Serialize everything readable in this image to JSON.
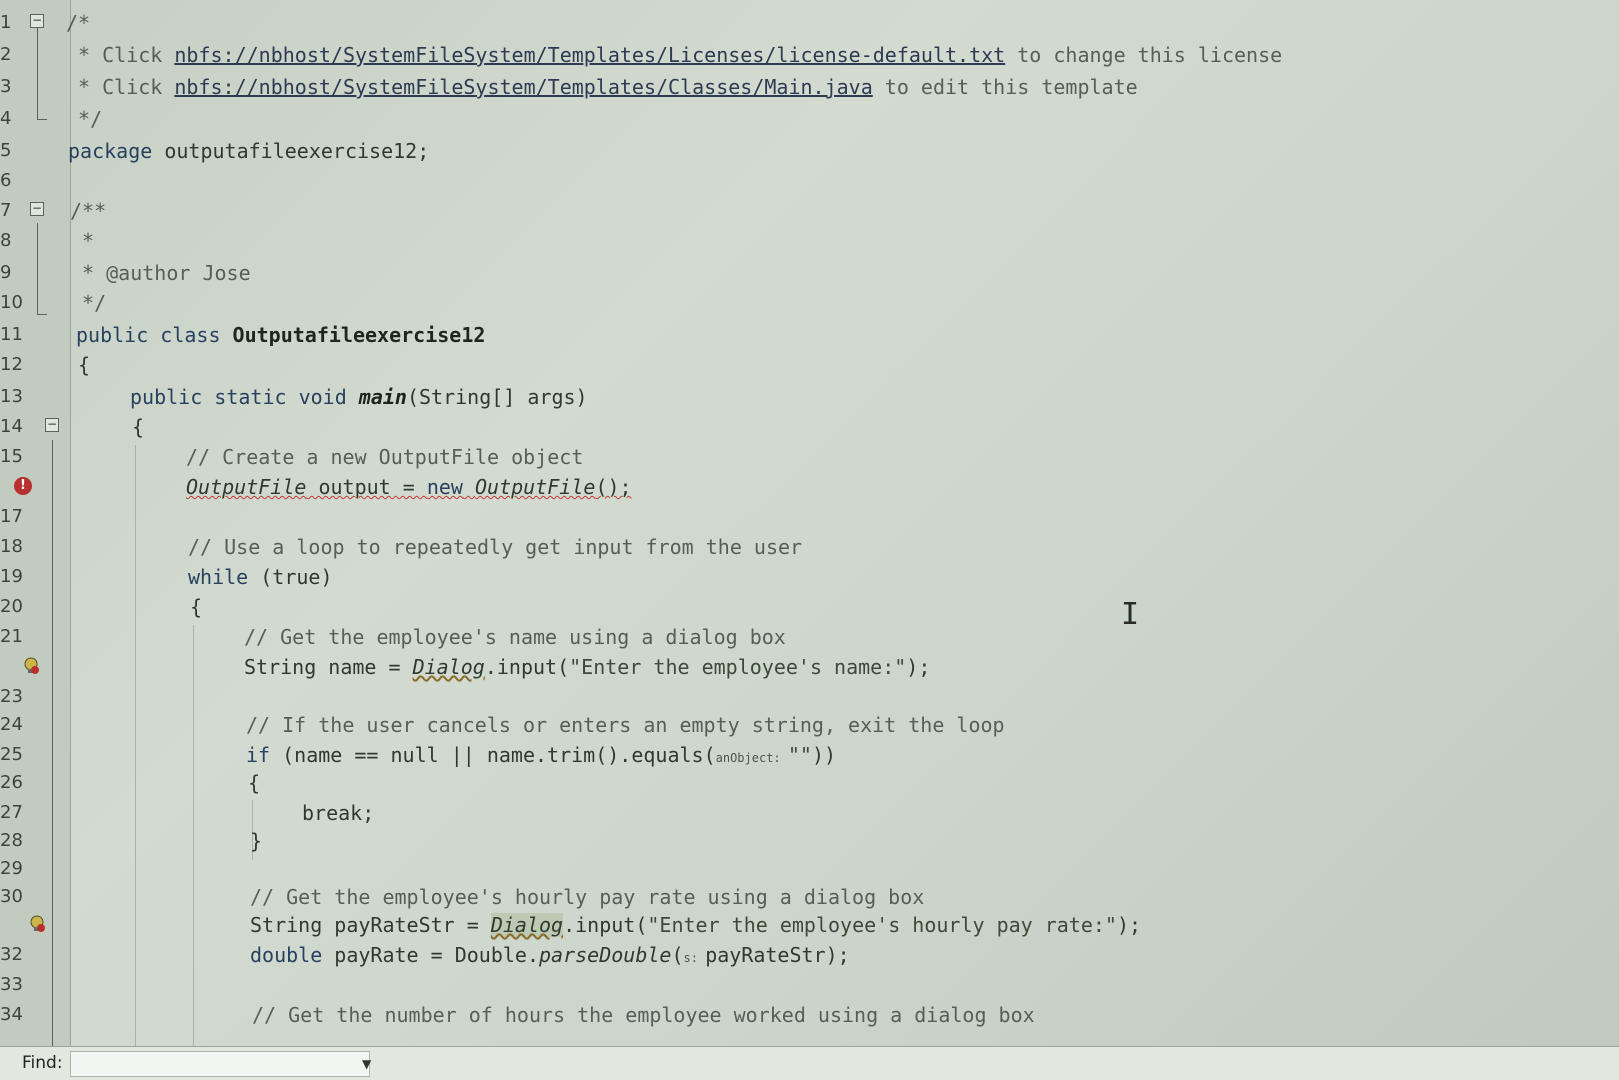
{
  "gutter": {
    "numbers": [
      "1",
      "2",
      "3",
      "4",
      "5",
      "6",
      "7",
      "8",
      "9",
      "10",
      "11",
      "12",
      "13",
      "14",
      "15",
      "",
      "17",
      "18",
      "19",
      "20",
      "21",
      "",
      "23",
      "24",
      "25",
      "26",
      "27",
      "28",
      "29",
      "30",
      "",
      "32",
      "33",
      "34"
    ]
  },
  "code": {
    "l1": "/*",
    "l2_pre": " * Click ",
    "l2_link": "nbfs://nbhost/SystemFileSystem/Templates/Licenses/license-default.txt",
    "l2_post": " to change this license",
    "l3_pre": " * Click ",
    "l3_link": "nbfs://nbhost/SystemFileSystem/Templates/Classes/Main.java",
    "l3_post": " to edit this template",
    "l4": " */",
    "l5_kw": "package",
    "l5_rest": " outputafileexercise12;",
    "l7": "/**",
    "l8": " *",
    "l9": " * @author Jose",
    "l10": " */",
    "l11_kw": "public class ",
    "l11_cls": "Outputafileexercise12",
    "l12": "{",
    "l13_kw": "public static void ",
    "l13_method": "main",
    "l13_rest": "(String[] args)",
    "l14": "{",
    "l15": "// Create a new OutputFile object",
    "l16_a": "OutputFile",
    "l16_b": " output = ",
    "l16_c": "new",
    "l16_d": " ",
    "l16_e": "OutputFile",
    "l16_f": "();",
    "l18": "// Use a loop to repeatedly get input from the user",
    "l19_kw": "while",
    "l19_rest": " (true)",
    "l20": "{",
    "l21": "// Get the employee's name using a dialog box",
    "l22_a": "String name = ",
    "l22_b": "Dialog",
    "l22_c": ".input(",
    "l22_str": "\"Enter the employee's name:\"",
    "l22_d": ");",
    "l24": "// If the user cancels or enters an empty string, exit the loop",
    "l25_kw": "if",
    "l25_a": " (name == null || name.trim().equals(",
    "l25_hint": "anObject: ",
    "l25_str": "\"\"",
    "l25_b": "))",
    "l26": "{",
    "l27": "break;",
    "l28": "}",
    "l30": "// Get the employee's hourly pay rate using a dialog box",
    "l31_a": "String payRateStr = ",
    "l31_b": "Dialog",
    "l31_c": ".input(",
    "l31_str": "\"Enter the employee's hourly pay rate:\"",
    "l31_d": ");",
    "l32_kw": "double",
    "l32_a": " payRate = Double.",
    "l32_m": "parseDouble",
    "l32_b": "(",
    "l32_hint": "s: ",
    "l32_c": "payRateStr);",
    "l34": "// Get the number of hours the employee worked using a dialog box"
  },
  "findbar": {
    "label": "Find:",
    "value": ""
  },
  "colors": {
    "error": "#b8302e",
    "keyword": "#27415f",
    "comment": "#555f58"
  },
  "icons": {
    "error": "error-icon",
    "hint": "lightbulb-icon",
    "fold": "fold-toggle-icon",
    "cursor": "text-cursor-icon"
  }
}
